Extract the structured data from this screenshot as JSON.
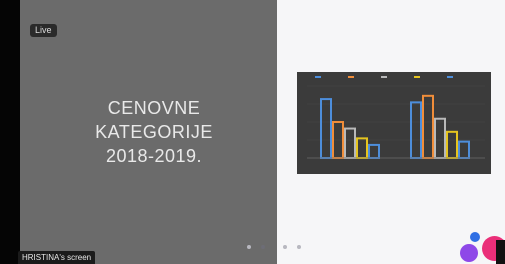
{
  "badge": "Live",
  "slide": {
    "title_lines": [
      "CENOVNE",
      "KATEGORIJE",
      "2018-2019."
    ]
  },
  "screen_label": "HRISTINA's screen",
  "pager": {
    "count": 4,
    "active_index": 1
  },
  "chart_data": {
    "type": "bar",
    "categories": [
      "",
      ""
    ],
    "series": [
      {
        "color": "#4d8edc",
        "values": [
          18,
          17
        ]
      },
      {
        "color": "#f08d3a",
        "values": [
          11,
          19
        ]
      },
      {
        "color": "#b9b9b9",
        "values": [
          9,
          12
        ]
      },
      {
        "color": "#e5c41f",
        "values": [
          6,
          8
        ]
      },
      {
        "color": "#4d8edc",
        "values": [
          4,
          5
        ]
      }
    ],
    "ylim": [
      0,
      22
    ]
  }
}
